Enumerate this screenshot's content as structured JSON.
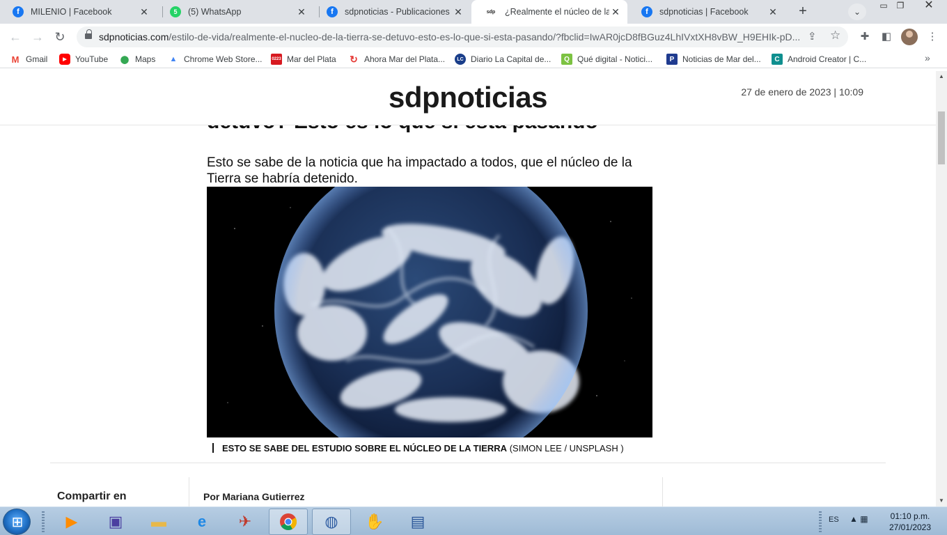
{
  "browser": {
    "tabs": [
      {
        "title": "MILENIO | Facebook",
        "favicon": "facebook-icon",
        "active": false
      },
      {
        "title": "(5) WhatsApp",
        "favicon": "whatsapp-icon",
        "badge": "5",
        "active": false
      },
      {
        "title": "sdpnoticias - Publicaciones | Fa",
        "favicon": "facebook-icon",
        "active": false
      },
      {
        "title": "¿Realmente el núcleo de la Tie",
        "favicon": "sdp-icon",
        "favicon_text": "sdp",
        "active": true
      },
      {
        "title": "sdpnoticias | Facebook",
        "favicon": "facebook-icon",
        "active": false
      }
    ],
    "url_host": "sdpnoticias.com",
    "url_path": "/estilo-de-vida/realmente-el-nucleo-de-la-tierra-se-detuvo-esto-es-lo-que-si-esta-pasando/?fbclid=IwAR0jcD8fBGuz4LhIVxtXH8vBW_H9EHIk-pD...",
    "bookmarks": [
      {
        "label": "Gmail",
        "icon": "gmail-icon",
        "color": "#ea4335",
        "glyph": "M"
      },
      {
        "label": "YouTube",
        "icon": "youtube-icon",
        "color": "#ff0000",
        "glyph": "▶"
      },
      {
        "label": "Maps",
        "icon": "maps-icon",
        "color": "#34a853",
        "glyph": "⬤"
      },
      {
        "label": "Chrome Web Store...",
        "icon": "chrome-web-store-icon",
        "color": "#4285f4",
        "glyph": "▲"
      },
      {
        "label": "Mar del Plata",
        "icon": "mdp-0223-icon",
        "color": "#d71920",
        "glyph": "0223"
      },
      {
        "label": "Ahora Mar del Plata...",
        "icon": "ahora-mdp-icon",
        "color": "#e53935",
        "glyph": "↻"
      },
      {
        "label": "Diario La Capital de...",
        "icon": "la-capital-icon",
        "color": "#1a3e8a",
        "glyph": "LC"
      },
      {
        "label": "Qué digital - Notici...",
        "icon": "que-digital-icon",
        "color": "#7cc242",
        "glyph": "Q"
      },
      {
        "label": "Noticias de Mar del...",
        "icon": "noticias-mdp-icon",
        "color": "#1f3b8f",
        "glyph": "P"
      },
      {
        "label": "Android Creator | C...",
        "icon": "android-creator-icon",
        "color": "#0f8f8f",
        "glyph": "C"
      }
    ]
  },
  "page": {
    "site_name": "sdpnoticias",
    "date": "27 de enero de 2023 | 10:09",
    "headline_fragment": "detuvo? Esto es lo que sí está pasando",
    "lead": "Esto se sabe de la noticia que ha impactado a todos, que el núcleo de la Tierra se habría detenido.",
    "image_caption": "ESTO SE SABE DEL ESTUDIO SOBRE EL NÚCLEO DE LA TIERRA",
    "image_credit": "(SIMON LEE / UNSPLASH )",
    "share_label": "Compartir en",
    "byline": "Por Mariana Gutierrez"
  },
  "taskbar": {
    "language": "ES",
    "time": "01:10 p.m.",
    "date": "27/01/2023"
  }
}
